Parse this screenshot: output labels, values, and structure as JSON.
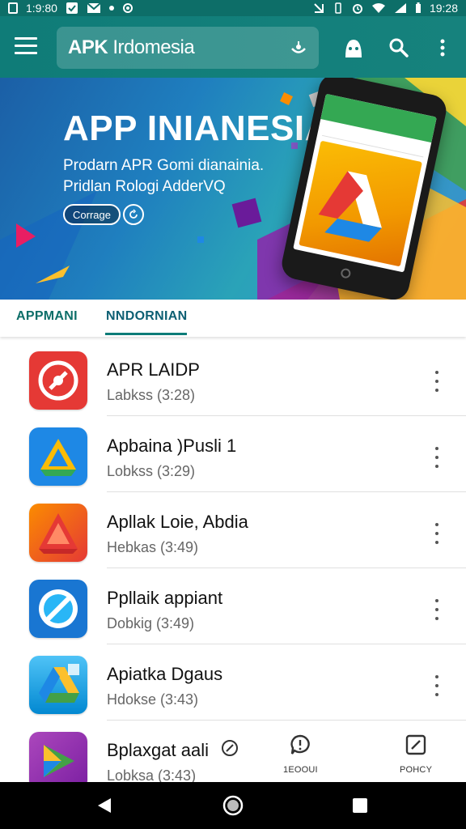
{
  "status_bar": {
    "left_time": "1:9:80",
    "right_time": "19:28"
  },
  "app_bar": {
    "title_bold": "APK",
    "title_rest": "Irdomesia"
  },
  "banner": {
    "title": "APP INIANESIA",
    "subtitle_line1": "Prodarn APR Gomi dianainia.",
    "subtitle_line2": "Pridlan Rologi AdderVQ",
    "button_label": "Corrage"
  },
  "tabs": [
    {
      "label": "APPMANI",
      "active": false
    },
    {
      "label": "NNDORNIAN",
      "active": true
    }
  ],
  "apps": [
    {
      "name": "APR LAIDP",
      "meta": "Labkss (3:28)",
      "icon": "red-circle-app-icon",
      "colors": [
        "#e53935",
        "#c62828"
      ]
    },
    {
      "name": "Apbaina )Pusli 1",
      "meta": "Lobkss (3:29)",
      "icon": "blue-triangle-app-icon",
      "colors": [
        "#1e88e5",
        "#fbbc05"
      ]
    },
    {
      "name": "Apllak Loie, Abdia",
      "meta": "Hebkas (3:49)",
      "icon": "orange-triangle-app-icon",
      "colors": [
        "#f57c00",
        "#e53935"
      ]
    },
    {
      "name": "Ppllaik appiant",
      "meta": "Dobkig (3:49)",
      "icon": "blue-compass-app-icon",
      "colors": [
        "#1976d2",
        "#ffffff"
      ]
    },
    {
      "name": "Apiatka Dgaus",
      "meta": "Hdokse (3:43)",
      "icon": "drive-app-icon",
      "colors": [
        "#29b6f6",
        "#fbc02d"
      ]
    },
    {
      "name": "Bplaxgat aali",
      "meta": "Lobksa (3:43)",
      "icon": "purple-play-app-icon",
      "colors": [
        "#8e24aa",
        "#43a047"
      ]
    }
  ],
  "bottom_actions": [
    {
      "label": "1EOOUI",
      "icon": "chat-icon"
    },
    {
      "label": "POHCY",
      "icon": "edit-icon"
    }
  ],
  "colors": {
    "primary": "#0d6e68",
    "accent": "#0d7c78"
  }
}
